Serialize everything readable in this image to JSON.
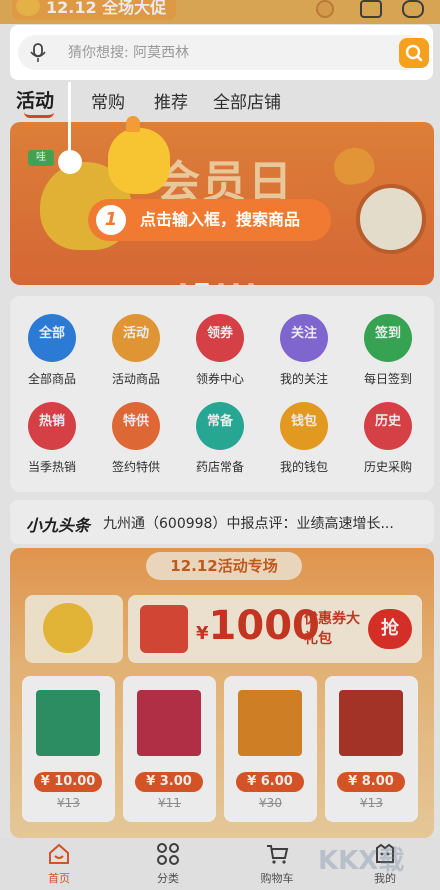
{
  "top": {
    "promo": "12.12 全场大促"
  },
  "search": {
    "placeholder": "猜你想搜: 阿莫西林"
  },
  "tabs": [
    "活动",
    "常购",
    "推荐",
    "全部店铺"
  ],
  "banner": {
    "title": "会员日",
    "tag": "哇"
  },
  "guide": {
    "step": "1",
    "text": "点击输入框，搜索商品"
  },
  "quick": [
    {
      "icon": "全部",
      "label": "全部商品",
      "color": "#2f86e6"
    },
    {
      "icon": "活动",
      "label": "活动商品",
      "color": "#f4a23a"
    },
    {
      "icon": "领券",
      "label": "领券中心",
      "color": "#e8464c"
    },
    {
      "icon": "关注",
      "label": "我的关注",
      "color": "#8a6fe0"
    },
    {
      "icon": "签到",
      "label": "每日签到",
      "color": "#3bb15a"
    },
    {
      "icon": "热销",
      "label": "当季热销",
      "color": "#e8464c"
    },
    {
      "icon": "特供",
      "label": "签约特供",
      "color": "#f0703a"
    },
    {
      "icon": "常备",
      "label": "药店常备",
      "color": "#2bb6a0"
    },
    {
      "icon": "钱包",
      "label": "我的钱包",
      "color": "#f5a623"
    },
    {
      "icon": "历史",
      "label": "历史采购",
      "color": "#e8464c"
    }
  ],
  "news": {
    "logo": "小九头条",
    "text": "九州通（600998）中报点评：业绩高速增长..."
  },
  "activity": {
    "title": "12.12活动专场",
    "coupon_currency": "¥",
    "coupon_amount": "1000",
    "coupon_sub": "优惠券大礼包",
    "grab": "抢",
    "products": [
      {
        "price": "¥ 10.00",
        "old": "¥13",
        "color": "#2f9a6a"
      },
      {
        "price": "¥ 3.00",
        "old": "¥11",
        "color": "#c0344a"
      },
      {
        "price": "¥ 6.00",
        "old": "¥30",
        "color": "#e08a2a"
      },
      {
        "price": "¥ 8.00",
        "old": "¥13",
        "color": "#b0382a"
      }
    ]
  },
  "nav": [
    "首页",
    "分类",
    "购物车",
    "我的"
  ],
  "watermark": "KKX载"
}
